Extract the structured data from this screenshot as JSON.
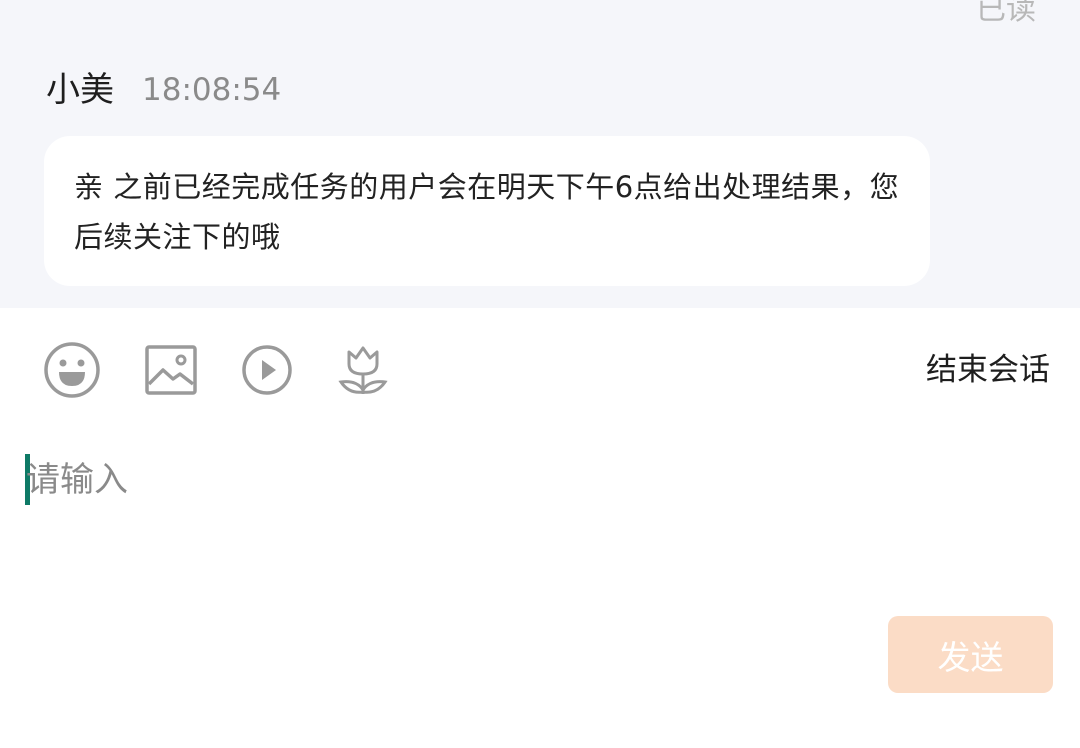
{
  "chat": {
    "read_status": "已读",
    "message": {
      "sender": "小美",
      "time": "18:08:54",
      "text": "亲  之前已经完成任务的用户会在明天下午6点给出处理结果，您后续关注下的哦"
    }
  },
  "toolbar": {
    "icons": [
      "emoji-icon",
      "image-icon",
      "video-icon",
      "flower-icon"
    ],
    "end_session_label": "结束会话"
  },
  "composer": {
    "placeholder": "请输入",
    "value": "",
    "send_label": "发送"
  },
  "colors": {
    "chat_background": "#f5f6fa",
    "bubble_background": "#ffffff",
    "cursor": "#0e7a66",
    "send_button_disabled": "#fbdcc6"
  }
}
